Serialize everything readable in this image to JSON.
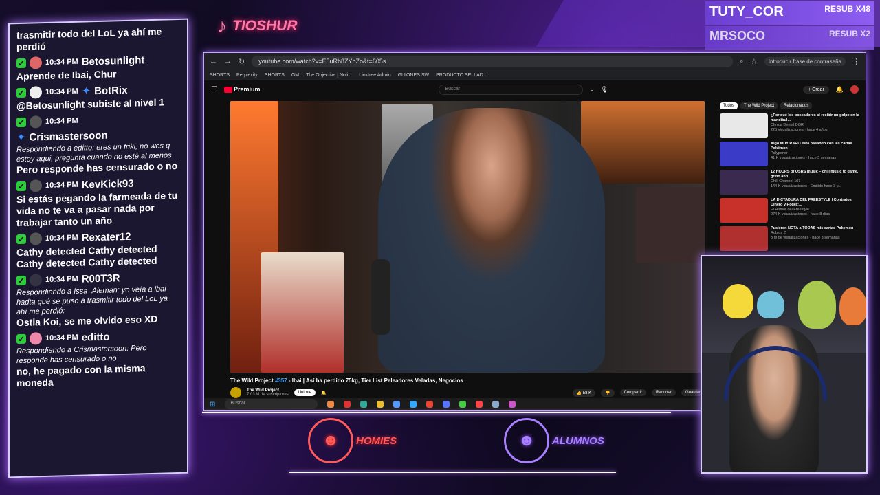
{
  "tiktok": {
    "name": "TIOSHUR"
  },
  "subs": [
    {
      "name": "TUTY_COR",
      "resub": "RESUB X48"
    },
    {
      "name": "MRSOCO",
      "resub": "RESUB X2"
    }
  ],
  "chat": [
    {
      "user": "",
      "time": "",
      "text": "trasmitir todo del LoL ya ahí me perdió"
    },
    {
      "user": "Betosunlight",
      "time": "10:34 PM",
      "text": "Aprende de Ibai, Chur"
    },
    {
      "user": "BotRix",
      "time": "10:34 PM",
      "text": "@Betosunlight subiste al nivel 1"
    },
    {
      "user": "Crismastersoon",
      "time": "10:34 PM",
      "reply": "Respondiendo a editto: eres un friki, no wes q estoy aqui, pregunta cuando no esté al menos",
      "text": "Pero responde has censurado o no"
    },
    {
      "user": "KevKick93",
      "time": "10:34 PM",
      "text": "Si estás pegando la farmeada de tu vida no te va a pasar nada por trabajar tanto un año"
    },
    {
      "user": "Rexater12",
      "time": "10:34 PM",
      "text": "Cathy detected Cathy detected Cathy detected Cathy detected"
    },
    {
      "user": "R00T3R",
      "time": "10:34 PM",
      "reply": "Respondiendo a Issa_Aleman: yo veía a ibai hadta qué se puso a trasmitir todo del LoL ya ahí me perdió:",
      "text": "Ostia Koi, se me olvido eso XD"
    },
    {
      "user": "editto",
      "time": "10:34 PM",
      "reply": "Respondiendo a Crismastersoon: Pero responde has censurado o no",
      "text": "no, he pagado con la misma moneda"
    }
  ],
  "browser": {
    "url": "youtube.com/watch?v=E5uRb8ZYbZo&t=605s",
    "password_prompt": "Introducir frase de contraseña",
    "bookmarks": [
      "SHORTS",
      "Perplexity",
      "SHORTS",
      "GM",
      "The Objective | Noti...",
      "Linktree Admin",
      "GUIONES SW",
      "PRODUCTO SELLAD..."
    ],
    "premium": "Premium",
    "search_placeholder": "Buscar",
    "create": "Crear"
  },
  "video": {
    "channel_prefix": "The Wild Project ",
    "episode": "#357",
    "title_rest": " - Ibai | Así ha perdido 75kg, Tier List Peleadores Veladas, Negocios",
    "channel": "The Wild Project",
    "subs": "7,03 M de suscriptores",
    "join": "Unirme",
    "likes": "58 K",
    "share": "Compartir",
    "clip": "Recortar",
    "save": "Guardar"
  },
  "chips": [
    "Todos",
    "The Wild Project",
    "Relacionados"
  ],
  "recommendations": [
    {
      "title": "¿Por qué los boxeadores al recibir un golpe en la mandíbul...",
      "channel": "Clínica Dental DOR",
      "meta": "225 visualizaciones · hace 4 años",
      "color": "#e8e8e8"
    },
    {
      "title": "Algo MUY RARO está pasando con las cartas Pokémon",
      "channel": "Polypenqr",
      "meta": "41 K visualizaciones · hace 3 semanas",
      "color": "#3a3cc8"
    },
    {
      "title": "12 HOURS of OSRS music – chill music to game, grind and ...",
      "channel": "Chill Channel 101",
      "meta": "144 K visualizaciones · Emitido hace 3 y...",
      "color": "#3a2a50"
    },
    {
      "title": "LA DICTADURA DEL FREESTYLE | Contratos, Dinero y Poder:...",
      "channel": "El Humor del Freestyle",
      "meta": "274 K visualizaciones · hace 8 días",
      "color": "#c8302a"
    },
    {
      "title": "Pusieron NOTA a TODAS mis cartas Pokemon",
      "channel": "Rubius Z",
      "meta": "3 M de visualizaciones · hace 3 semanas",
      "color": "#b03030"
    }
  ],
  "taskbar": {
    "search": "Buscar"
  },
  "badges": [
    {
      "label": "HOMIES",
      "color": "#ff5a5a"
    },
    {
      "label": "ALUMNOS",
      "color": "#a880ff"
    }
  ]
}
